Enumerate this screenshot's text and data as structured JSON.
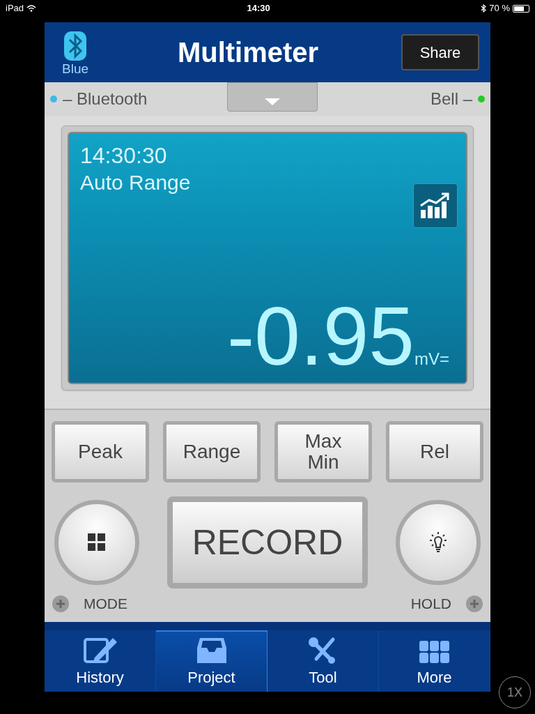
{
  "status_bar": {
    "device": "iPad",
    "time": "14:30",
    "battery": "70 %"
  },
  "header": {
    "bluetooth_label": "Blue",
    "title": "Multimeter",
    "share": "Share"
  },
  "indicators": [
    {
      "label": "– Bluetooth",
      "color": "#3fb8e8"
    },
    {
      "label": "Bell –",
      "color": "#22cc22"
    }
  ],
  "display": {
    "time": "14:30:30",
    "mode": "Auto Range",
    "value": "-0.95",
    "unit": "mV="
  },
  "function_buttons": [
    {
      "label": "Peak"
    },
    {
      "label": "Range"
    },
    {
      "label": "Max\nMin"
    },
    {
      "label": "Rel"
    }
  ],
  "mode_label": "MODE",
  "record": "RECORD",
  "hold_label": "HOLD",
  "tabs": [
    {
      "label": "History",
      "selected": false
    },
    {
      "label": "Project",
      "selected": true
    },
    {
      "label": "Tool",
      "selected": false
    },
    {
      "label": "More",
      "selected": false
    }
  ],
  "zoom_badge": "1X"
}
